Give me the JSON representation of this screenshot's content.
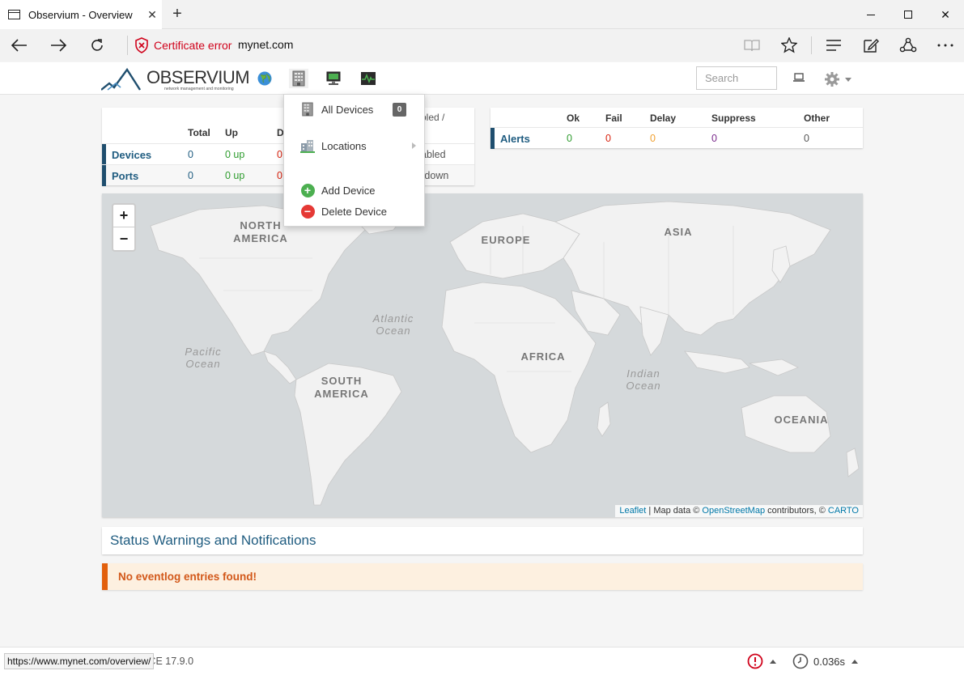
{
  "browser": {
    "tab_title": "Observium - Overview",
    "cert_error": "Certificate error",
    "url": "mynet.com",
    "status_url": "https://www.mynet.com/overview/"
  },
  "navbar": {
    "logo_text": "OBSERVIUM",
    "logo_tagline": "network management and monitoring",
    "search_placeholder": "Search"
  },
  "dropdown": {
    "items": [
      {
        "label": "All Devices",
        "badge": "0",
        "icon": "building-icon"
      },
      {
        "label": "Locations",
        "icon": "city-icon"
      },
      {
        "label": "Add Device",
        "icon": "plus-circle-icon"
      },
      {
        "label": "Delete Device",
        "icon": "minus-circle-icon"
      }
    ]
  },
  "device_table": {
    "headers": [
      "Total",
      "Up",
      "D",
      "bled /"
    ],
    "rows": [
      {
        "label": "Devices",
        "total": "0",
        "up": "0 up",
        "down": "0",
        "extra": "abled"
      },
      {
        "label": "Ports",
        "total": "0",
        "up": "0 up",
        "down": "0",
        "extra": "utdown"
      }
    ]
  },
  "alert_table": {
    "headers": [
      "Ok",
      "Fail",
      "Delay",
      "Suppress",
      "Other"
    ],
    "row": {
      "label": "Alerts",
      "ok": "0",
      "fail": "0",
      "delay": "0",
      "suppress": "0",
      "other": "0"
    }
  },
  "map": {
    "labels": {
      "north_america_1": "NORTH",
      "north_america_2": "AMERICA",
      "europe": "EUROPE",
      "asia": "ASIA",
      "africa": "AFRICA",
      "south_america_1": "SOUTH",
      "south_america_2": "AMERICA",
      "oceania": "OCEANIA",
      "atlantic_1": "Atlantic",
      "atlantic_2": "Ocean",
      "pacific_1": "Pacific",
      "pacific_2": "Ocean",
      "indian_1": "Indian",
      "indian_2": "Ocean"
    },
    "zoom_in": "+",
    "zoom_out": "−",
    "attribution": {
      "leaflet": "Leaflet",
      "sep": " | Map data © ",
      "osm": "OpenStreetMap",
      "contrib": " contributors, © ",
      "carto": "CARTO"
    },
    "colors": {
      "ocean": "#d5d9db",
      "land": "#f2f2f2"
    }
  },
  "status_section": {
    "title": "Status Warnings and Notifications"
  },
  "eventlog": {
    "message": "No eventlog entries found!"
  },
  "footer": {
    "version": "n CE 17.9.0",
    "time": "0.036s"
  }
}
